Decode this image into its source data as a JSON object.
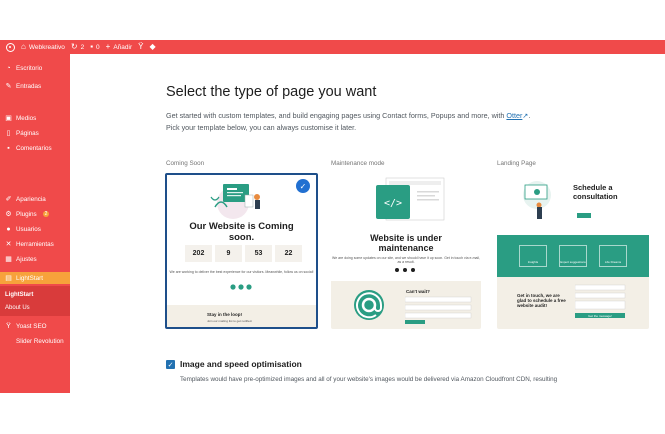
{
  "adminbar": {
    "site_name": "Webkreativo",
    "updates_count": "2",
    "comments_count": "0",
    "add_new": "Añadir"
  },
  "sidebar": {
    "items": [
      {
        "label": "Escritorio",
        "icon": "dashboard-icon"
      },
      {
        "label": "Entradas",
        "icon": "pin-icon"
      },
      {
        "label": "Medios",
        "icon": "media-icon"
      },
      {
        "label": "Páginas",
        "icon": "page-icon"
      },
      {
        "label": "Comentarios",
        "icon": "comment-icon"
      },
      {
        "label": "Apariencia",
        "icon": "brush-icon"
      },
      {
        "label": "Plugins",
        "icon": "plugin-icon",
        "badge": "2"
      },
      {
        "label": "Usuarios",
        "icon": "user-icon"
      },
      {
        "label": "Herramientas",
        "icon": "wrench-icon"
      },
      {
        "label": "Ajustes",
        "icon": "settings-icon"
      },
      {
        "label": "LightStart",
        "icon": "lightstart-icon"
      },
      {
        "label": "Yoast SEO",
        "icon": "yoast-icon"
      },
      {
        "label": "Slider Revolution",
        "icon": "slider-icon"
      }
    ],
    "submenu": [
      "LightStart",
      "About Us"
    ]
  },
  "main": {
    "title": "Select the type of page you want",
    "desc_line1": "Get started with custom templates, and build engaging pages using Contact forms, Popups and more, with",
    "otter_link": "Otter",
    "desc_line2": "Pick your template below, you can always customise it later."
  },
  "templates": [
    {
      "label": "Coming Soon",
      "title_line1": "Our Website is Coming",
      "title_line2": "soon.",
      "countdown": [
        "202",
        "9",
        "53",
        "22"
      ],
      "small_text": "We are working to deliver the best experience for our visitors. Meanwhile, follow us on social!",
      "footer_title": "Stay in the loop!",
      "footer_text": "Join our mailing list to get notified."
    },
    {
      "label": "Maintenance mode",
      "title_line1": "Website is under",
      "title_line2": "maintenance",
      "small_text": "We are doing some updates on our site, and we should have it up soon. Get in touch via e-mail, as a result.",
      "bottom_title": "Can't wait?"
    },
    {
      "label": "Landing Page",
      "title_line1": "Schedule a",
      "title_line2": "consultation",
      "features": [
        "Insights",
        "Expert suggestions",
        "Life Dreams"
      ],
      "bottom_title": "Get in touch, we are glad to schedule a free website audit!",
      "cta": "Get the message!"
    }
  ],
  "option": {
    "title": "Image and speed optimisation",
    "desc": "Templates would have pre-optimized images and all of your website's images would be delivered via Amazon Cloudfront CDN, resulting"
  },
  "colors": {
    "admin_red": "#f04a4a",
    "active_orange": "#f7a23b",
    "teal": "#2a9d83",
    "select_blue": "#1e4f8a",
    "link_blue": "#2271b1"
  }
}
